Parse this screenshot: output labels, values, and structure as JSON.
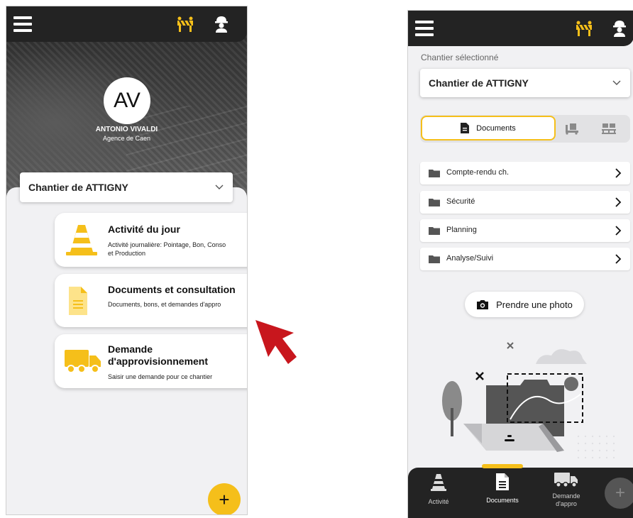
{
  "left_screen": {
    "avatar_initials": "AV",
    "user_name": "ANTONIO VIVALDI",
    "agency": "Agence de Caen",
    "site_selector": {
      "value": "Chantier de ATTIGNY"
    },
    "cards": [
      {
        "title": "Activité du jour",
        "subtitle": "Activité journalière: Pointage, Bon, Conso et Production",
        "icon": "traffic-cone-icon"
      },
      {
        "title": "Documents et consultation",
        "subtitle": "Documents, bons, et demandes d'appro",
        "icon": "document-icon"
      },
      {
        "title": "Demande d'approvisionnement",
        "subtitle": "Saisir une demande pour ce chantier",
        "icon": "truck-icon"
      }
    ],
    "fab_label": "+"
  },
  "right_screen": {
    "selected_site_label": "Chantier sélectionné",
    "site_selector": {
      "value": "Chantier de ATTIGNY"
    },
    "segments": {
      "active_label": "Documents"
    },
    "folders": [
      {
        "label": "Compte-rendu ch."
      },
      {
        "label": "Sécurité"
      },
      {
        "label": "Planning"
      },
      {
        "label": "Analyse/Suivi"
      }
    ],
    "photo_button": "Prendre une photo",
    "bottom_nav": [
      {
        "label": "Activité",
        "icon": "traffic-cone-icon"
      },
      {
        "label": "Documents",
        "icon": "document-icon",
        "active": true
      },
      {
        "label": "Demande d'appro",
        "icon": "truck-icon"
      }
    ],
    "fab_label": "+"
  },
  "colors": {
    "accent": "#f5bf1a",
    "dark_bar": "#232323",
    "background": "#f1f1f3",
    "arrow": "#c8161d"
  }
}
